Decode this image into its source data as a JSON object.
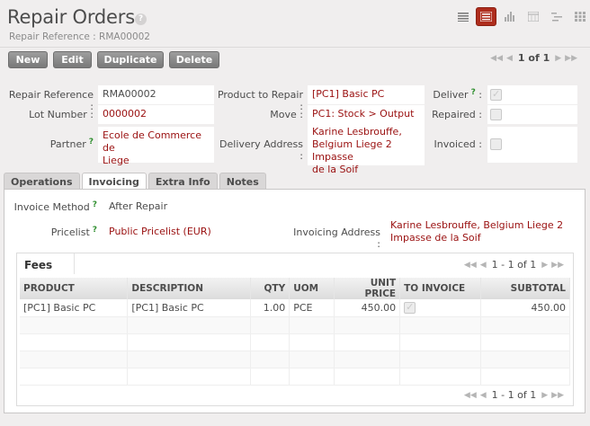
{
  "header": {
    "title": "Repair Orders",
    "help": "?",
    "breadcrumb": "Repair Reference : RMA00002"
  },
  "view_modes": [
    "list-view-icon",
    "form-view-icon",
    "graph-view-icon",
    "calendar-view-icon",
    "gantt-view-icon",
    "kanban-view-icon"
  ],
  "toolbar": {
    "new_label": "New",
    "edit_label": "Edit",
    "duplicate_label": "Duplicate",
    "delete_label": "Delete"
  },
  "pager": {
    "text": "1 of 1"
  },
  "form": {
    "repair_reference": {
      "label": "Repair Reference :",
      "value": "RMA00002"
    },
    "lot_number": {
      "label": "Lot Number :",
      "value": "0000002"
    },
    "partner": {
      "label": "Partner",
      "tip": "?",
      "value_line1": "Ecole de Commerce de",
      "value_line2": "Liege"
    },
    "product_to_repair": {
      "label": "Product to Repair :",
      "value": "[PC1] Basic PC"
    },
    "move": {
      "label": "Move :",
      "value": "PC1: Stock > Output"
    },
    "delivery_address": {
      "label": "Delivery Address :",
      "value_line1": "Karine Lesbrouffe,",
      "value_line2": "Belgium Liege 2 Impasse",
      "value_line3": "de la Soif"
    },
    "deliver": {
      "label": "Deliver",
      "tip": "?",
      "checked": true
    },
    "repaired": {
      "label": "Repaired :",
      "checked": false
    },
    "invoiced": {
      "label": "Invoiced :",
      "checked": false
    }
  },
  "tabs": [
    "Operations",
    "Invoicing",
    "Extra Info",
    "Notes"
  ],
  "invoicing": {
    "invoice_method": {
      "label": "Invoice Method",
      "tip": "?",
      "value": "After Repair"
    },
    "pricelist": {
      "label": "Pricelist",
      "tip": "?",
      "value": "Public Pricelist (EUR)"
    },
    "invoicing_address": {
      "label": "Invoicing Address :",
      "value_line1": "Karine Lesbrouffe, Belgium Liege 2",
      "value_line2": "Impasse de la Soif"
    }
  },
  "fees": {
    "title": "Fees",
    "pager": "1 - 1 of 1",
    "columns": [
      "PRODUCT",
      "DESCRIPTION",
      "QTY",
      "UOM",
      "UNIT PRICE",
      "TO INVOICE",
      "SUBTOTAL"
    ],
    "rows": [
      {
        "product": "[PC1] Basic PC",
        "description": "[PC1] Basic PC",
        "qty": "1.00",
        "uom": "PCE",
        "unit_price": "450.00",
        "to_invoice": true,
        "subtotal": "450.00"
      }
    ]
  },
  "colors": {
    "accent": "#ae2d1d",
    "link": "#9a1010",
    "tip": "#2f8f2f"
  }
}
